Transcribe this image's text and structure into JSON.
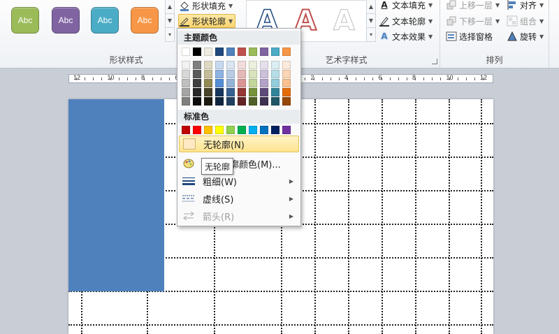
{
  "ribbon": {
    "shape_styles": {
      "label": "形状样式",
      "buttons": [
        {
          "text": "Abc",
          "color": "#9bbb59"
        },
        {
          "text": "Abc",
          "color": "#8064a2"
        },
        {
          "text": "Abc",
          "color": "#4bacc6"
        },
        {
          "text": "Abc",
          "color": "#f79646"
        }
      ],
      "fill_label": "形状填充",
      "outline_label": "形状轮廓"
    },
    "wordart": {
      "label": "艺术字样式",
      "samples": [
        "A",
        "A",
        "A"
      ],
      "text_fill": "文本填充",
      "text_outline": "文本轮廓",
      "text_effects": "文本效果"
    },
    "arrange": {
      "label": "排列",
      "bring_forward": "上移一层",
      "send_backward": "下移一层",
      "selection_pane": "选择窗格",
      "align": "对齐",
      "group": "组合",
      "rotate": "旋转"
    }
  },
  "ruler": {
    "numbers": [
      "12",
      "10",
      "8",
      "6",
      "4",
      "2",
      "0",
      "2",
      "4",
      "6",
      "8",
      "10",
      "12"
    ]
  },
  "menu": {
    "theme_colors_label": "主题颜色",
    "standard_colors_label": "标准色",
    "theme_colors": [
      "#ffffff",
      "#000000",
      "#eeece1",
      "#1f497d",
      "#4f81bd",
      "#c0504d",
      "#9bbb59",
      "#8064a2",
      "#4bacc6",
      "#f79646"
    ],
    "theme_shades": [
      [
        "#f2f2f2",
        "#7f7f7f",
        "#ddd9c3",
        "#c6d9f0",
        "#dbe5f1",
        "#f2dcdb",
        "#ebf1dd",
        "#e5e0ec",
        "#dbeef3",
        "#fdeada"
      ],
      [
        "#d8d8d8",
        "#595959",
        "#c4bd97",
        "#8db3e2",
        "#b8cce4",
        "#e5b9b7",
        "#d7e3bc",
        "#ccc1d9",
        "#b7dde8",
        "#fbd5b5"
      ],
      [
        "#bfbfbf",
        "#3f3f3f",
        "#938953",
        "#548dd4",
        "#95b3d7",
        "#d99694",
        "#c3d69b",
        "#b2a2c7",
        "#92cddc",
        "#fac08f"
      ],
      [
        "#a5a5a5",
        "#262626",
        "#494429",
        "#17365d",
        "#366092",
        "#953734",
        "#76923c",
        "#5f497a",
        "#31859b",
        "#e36c09"
      ],
      [
        "#7f7f7f",
        "#0c0c0c",
        "#1d1b10",
        "#0f243e",
        "#244061",
        "#632423",
        "#4f6128",
        "#3f3151",
        "#205867",
        "#974806"
      ]
    ],
    "standard_colors": [
      "#c00000",
      "#ff0000",
      "#ffc000",
      "#ffff00",
      "#92d050",
      "#00b050",
      "#00b0f0",
      "#0070c0",
      "#002060",
      "#7030a0"
    ],
    "no_outline": "无轮廓(N)",
    "more_colors": "其他轮廓颜色(M)...",
    "weight": "粗细(W)",
    "dashes": "虚线(S)",
    "arrows": "箭头(R)"
  },
  "tooltip": "无轮廓",
  "slide": {
    "rect_color": "#4f81bd"
  }
}
